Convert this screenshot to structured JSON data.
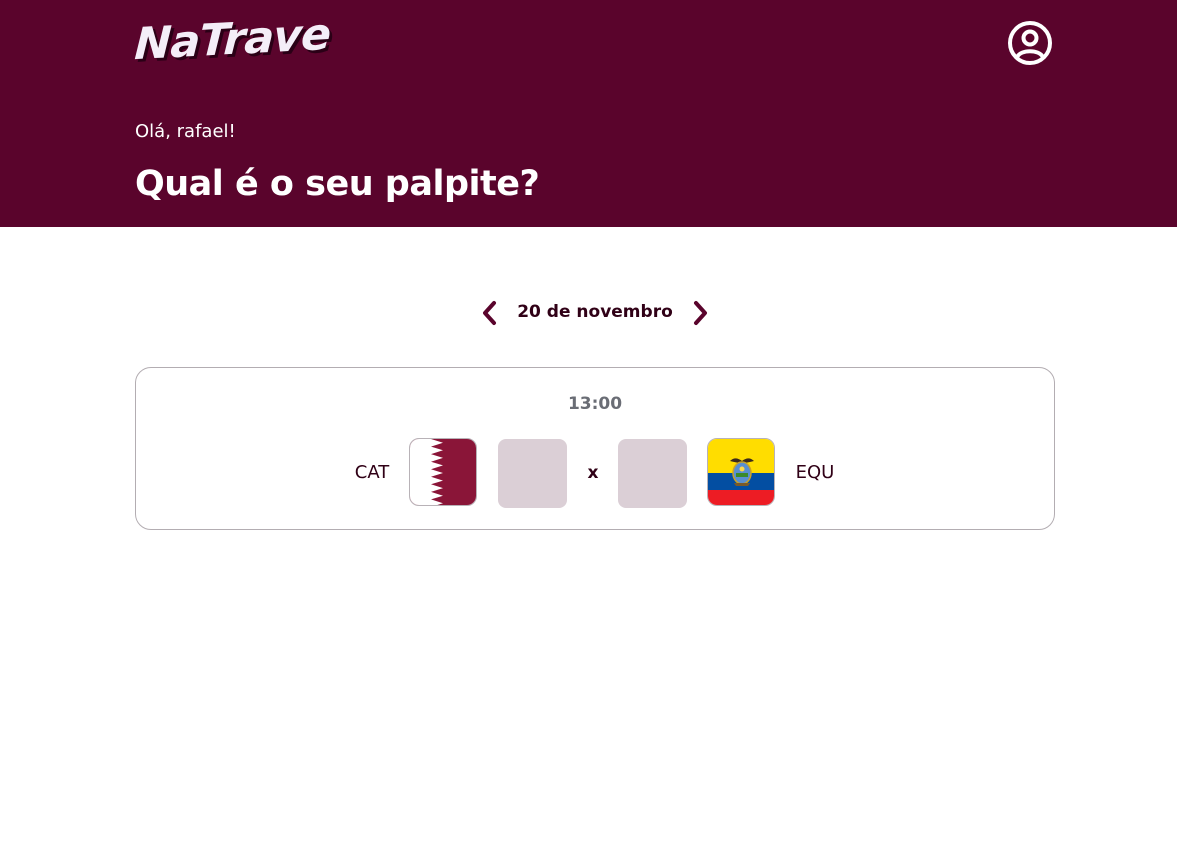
{
  "app": {
    "logo_text": "NaTrave"
  },
  "header": {
    "greeting": "Olá, rafael!",
    "headline": "Qual é o seu palpite?",
    "profile_icon": "user-circle-icon"
  },
  "date_nav": {
    "prev_icon": "chevron-left-icon",
    "next_icon": "chevron-right-icon",
    "date_label": "20 de novembro"
  },
  "match": {
    "time": "13:00",
    "home_team": {
      "code": "CAT",
      "flag_icon": "qatar-flag-icon",
      "score_value": "",
      "score_placeholder": ""
    },
    "separator": "x",
    "away_team": {
      "code": "EQU",
      "flag_icon": "ecuador-flag-icon",
      "score_value": "",
      "score_placeholder": ""
    }
  },
  "colors": {
    "brand": "#5a042c",
    "input_bg": "#dbcfd6",
    "text_dark": "#300016",
    "muted": "#6a6d75"
  }
}
